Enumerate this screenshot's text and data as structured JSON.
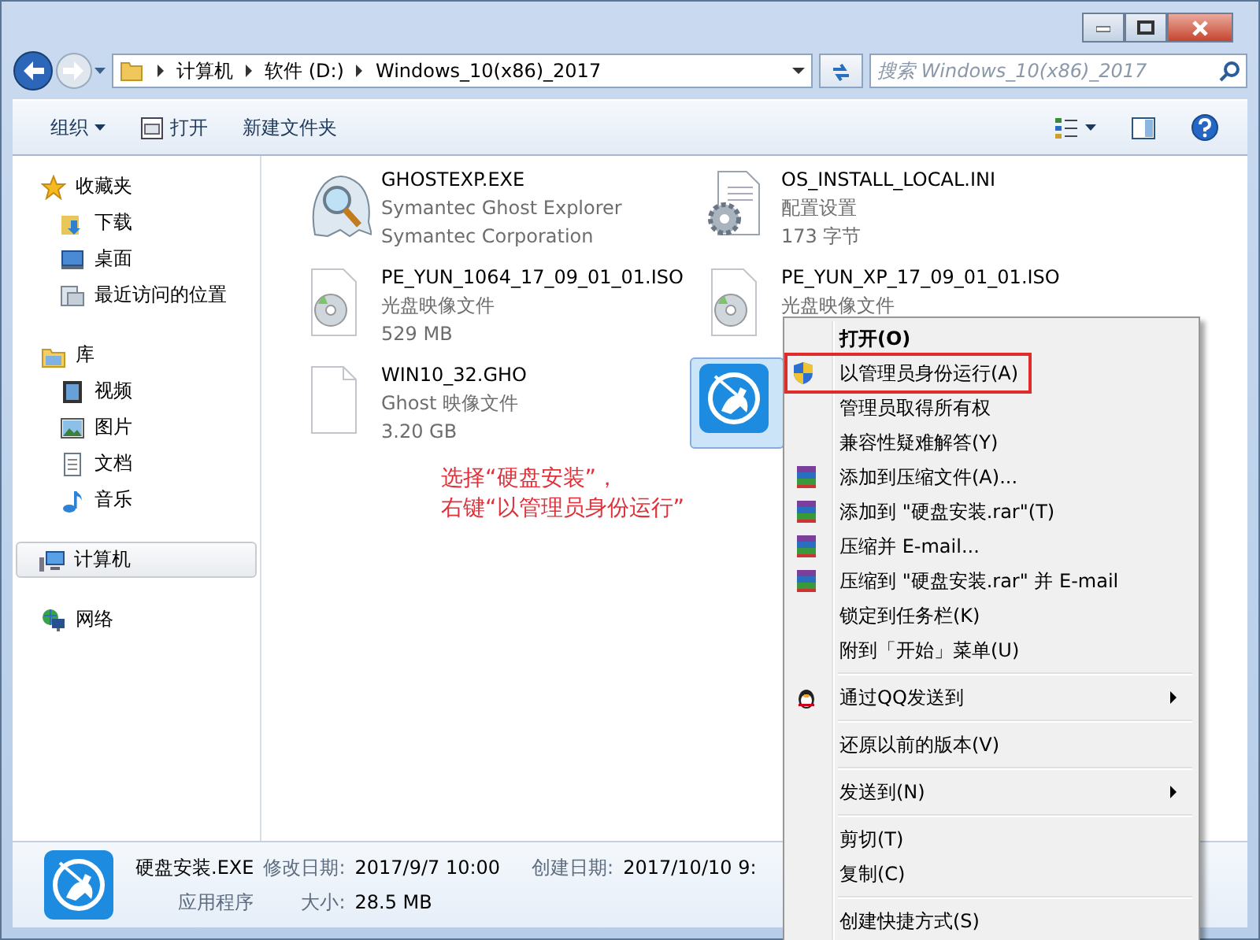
{
  "window": {
    "controls": [
      {
        "kind": "minimize"
      },
      {
        "kind": "maximize"
      },
      {
        "kind": "close"
      }
    ]
  },
  "address": {
    "segments": [
      "计算机",
      "软件 (D:)",
      "Windows_10(x86)_2017"
    ]
  },
  "search": {
    "placeholder": "搜索 Windows_10(x86)_2017"
  },
  "toolbar": {
    "items": [
      {
        "label": "组织",
        "kind": "dropdown"
      },
      {
        "label": "打开",
        "kind": "open"
      },
      {
        "label": "新建文件夹",
        "kind": "plain"
      }
    ]
  },
  "sidebar": {
    "groups": [
      {
        "label": "收藏夹",
        "kind": "favorites",
        "selected": false,
        "children": [
          {
            "label": "下载",
            "kind": "downloads",
            "selected": false
          },
          {
            "label": "桌面",
            "kind": "desktop",
            "selected": false
          },
          {
            "label": "最近访问的位置",
            "kind": "recent",
            "selected": false
          }
        ]
      },
      {
        "label": "库",
        "kind": "libraries",
        "selected": false,
        "children": [
          {
            "label": "视频",
            "kind": "videos",
            "selected": false
          },
          {
            "label": "图片",
            "kind": "pictures",
            "selected": false
          },
          {
            "label": "文档",
            "kind": "documents",
            "selected": false
          },
          {
            "label": "音乐",
            "kind": "music",
            "selected": false
          }
        ]
      },
      {
        "label": "计算机",
        "kind": "computer",
        "selected": true
      },
      {
        "label": "网络",
        "kind": "network",
        "selected": false
      }
    ]
  },
  "files": [
    {
      "name": "GHOSTEXP.EXE",
      "lines": [
        "Symantec Ghost Explorer",
        "Symantec Corporation"
      ],
      "kind": "ghost",
      "selected": false
    },
    {
      "name": "OS_INSTALL_LOCAL.INI",
      "lines": [
        "配置设置",
        "173 字节"
      ],
      "kind": "config",
      "selected": false
    },
    {
      "name": "PE_YUN_1064_17_09_01_01.ISO",
      "lines": [
        "光盘映像文件",
        "529 MB"
      ],
      "kind": "disc",
      "selected": false
    },
    {
      "name": "PE_YUN_XP_17_09_01_01.ISO",
      "lines": [
        "光盘映像文件"
      ],
      "kind": "disc",
      "selected": false
    },
    {
      "name": "WIN10_32.GHO",
      "lines": [
        "Ghost 映像文件",
        "3.20 GB"
      ],
      "kind": "blank",
      "selected": false
    },
    {
      "kind": "app",
      "selected": true
    }
  ],
  "annotation": {
    "lines": [
      "选择“硬盘安装”，",
      "右键“以管理员身份运行”"
    ]
  },
  "context_menu": {
    "items": [
      {
        "kind": "command",
        "label": "打开(O)",
        "bold": true,
        "submenu": false,
        "highlighted": false
      },
      {
        "kind": "admin",
        "label": "以管理员身份运行(A)",
        "bold": false,
        "submenu": false,
        "highlighted": true
      },
      {
        "kind": "command",
        "label": "管理员取得所有权",
        "bold": false,
        "submenu": false,
        "highlighted": false
      },
      {
        "kind": "command",
        "label": "兼容性疑难解答(Y)",
        "bold": false,
        "submenu": false,
        "highlighted": false
      },
      {
        "kind": "archive",
        "label": "添加到压缩文件(A)...",
        "bold": false,
        "submenu": false,
        "highlighted": false
      },
      {
        "kind": "archive",
        "label": "添加到 \"硬盘安装.rar\"(T)",
        "bold": false,
        "submenu": false,
        "highlighted": false
      },
      {
        "kind": "archive",
        "label": "压缩并 E-mail...",
        "bold": false,
        "submenu": false,
        "highlighted": false
      },
      {
        "kind": "archive",
        "label": "压缩到 \"硬盘安装.rar\" 并 E-mail",
        "bold": false,
        "submenu": false,
        "highlighted": false
      },
      {
        "kind": "command",
        "label": "锁定到任务栏(K)",
        "bold": false,
        "submenu": false,
        "highlighted": false
      },
      {
        "kind": "command",
        "label": "附到「开始」菜单(U)",
        "bold": false,
        "submenu": false,
        "highlighted": false
      },
      {
        "kind": "separator"
      },
      {
        "kind": "qq",
        "label": "通过QQ发送到",
        "bold": false,
        "submenu": true,
        "highlighted": false
      },
      {
        "kind": "separator"
      },
      {
        "kind": "command",
        "label": "还原以前的版本(V)",
        "bold": false,
        "submenu": false,
        "highlighted": false
      },
      {
        "kind": "separator"
      },
      {
        "kind": "command",
        "label": "发送到(N)",
        "bold": false,
        "submenu": true,
        "highlighted": false
      },
      {
        "kind": "separator"
      },
      {
        "kind": "command",
        "label": "剪切(T)",
        "bold": false,
        "submenu": false,
        "highlighted": false
      },
      {
        "kind": "command",
        "label": "复制(C)",
        "bold": false,
        "submenu": false,
        "highlighted": false
      },
      {
        "kind": "separator"
      },
      {
        "kind": "command",
        "label": "创建快捷方式(S)",
        "bold": false,
        "submenu": false,
        "highlighted": false
      }
    ]
  },
  "details": {
    "name": "硬盘安装.EXE",
    "type": "应用程序",
    "fields": [
      {
        "label": "修改日期:",
        "value": "2017/9/7 10:00"
      },
      {
        "label": "大小:",
        "value": "28.5 MB"
      },
      {
        "label": "创建日期:",
        "value": "2017/10/10 9:"
      }
    ]
  }
}
